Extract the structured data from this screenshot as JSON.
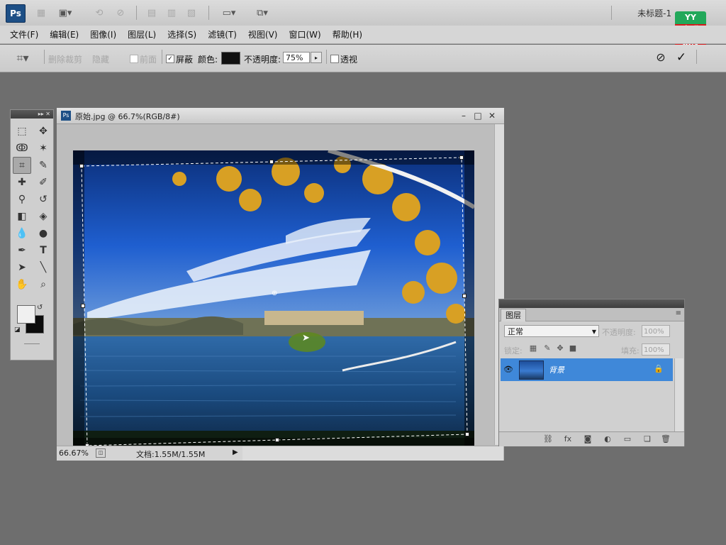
{
  "app": {
    "logo": "Ps",
    "workspace_label": "未标题-1",
    "brand_top": "YY",
    "brand_bottom_line1": "育碟",
    "brand_bottom_line2": "教育"
  },
  "menu": [
    "文件(F)",
    "编辑(E)",
    "图像(I)",
    "图层(L)",
    "选择(S)",
    "滤镜(T)",
    "视图(V)",
    "窗口(W)",
    "帮助(H)"
  ],
  "options": {
    "dim_labels": [
      "删除裁剪",
      "隐藏",
      "前面"
    ],
    "shield_label": "屏蔽",
    "shield_checked": true,
    "color_label": "颜色:",
    "shield_color": "#111111",
    "opacity_label": "不透明度:",
    "opacity_value": "75%",
    "perspective_label": "透视",
    "perspective_checked": false
  },
  "document": {
    "title": "原始.jpg @ 66.7%(RGB/8#)",
    "zoom": "66.67%",
    "doc_size": "文档:1.55M/1.55M"
  },
  "layers": {
    "tab_label": "图层",
    "blend_mode": "正常",
    "opacity_label": "不透明度:",
    "opacity_value": "100%",
    "lock_label": "锁定:",
    "fill_label": "填充:",
    "fill_value": "100%",
    "items": [
      {
        "name": "背景",
        "visible": true,
        "locked": true,
        "selected": true
      }
    ]
  },
  "colors": {
    "accent": "#3f88d9",
    "foreground": "#f0f0f0",
    "background": "#0c0c0c"
  }
}
